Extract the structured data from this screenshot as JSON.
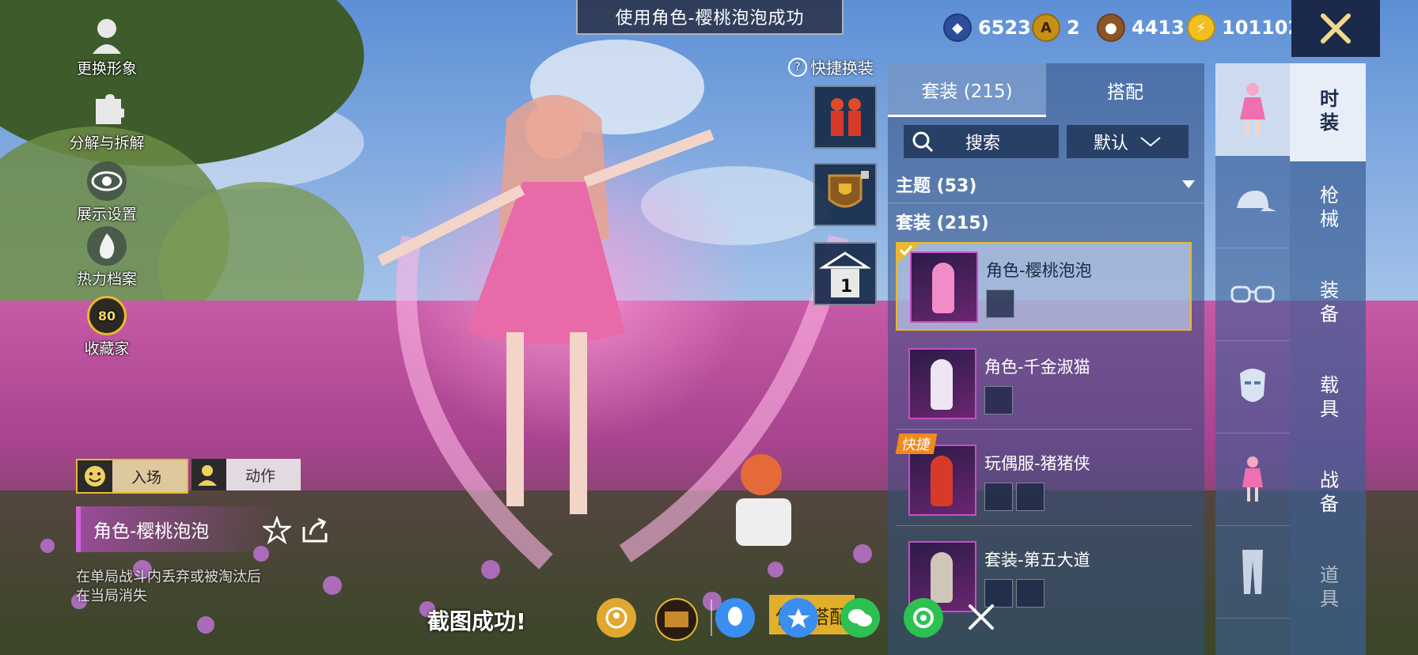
{
  "toast": "使用角色-樱桃泡泡成功",
  "currencies": [
    {
      "icon": "sapphire-coin-icon",
      "value": "6523"
    },
    {
      "icon": "gold-a-coin-icon",
      "value": "2"
    },
    {
      "icon": "bronze-coin-icon",
      "value": "4413"
    },
    {
      "icon": "lightning-coin-icon",
      "value": "101102"
    }
  ],
  "left_tools": [
    {
      "icon": "avatar-icon",
      "label": "更换形象"
    },
    {
      "icon": "puzzle-icon",
      "label": "分解与拆解"
    },
    {
      "icon": "eye-icon",
      "label": "展示设置"
    },
    {
      "icon": "flame-icon",
      "label": "热力档案"
    },
    {
      "icon": "collection-badge-icon",
      "label": "收藏家",
      "badge": "80"
    }
  ],
  "quick_change": {
    "label": "快捷换装",
    "help_icon": "?"
  },
  "quick_slots": [
    {
      "icon": "pig-suit-icon"
    },
    {
      "icon": "trophy-lock-icon"
    },
    {
      "icon": "hanger-icon",
      "count": "1"
    }
  ],
  "panel": {
    "tabs": [
      {
        "label": "套装 (215)",
        "active": true
      },
      {
        "label": "搭配",
        "active": false
      }
    ],
    "search_placeholder": "搜索",
    "sort_label": "默认",
    "theme_section": "主题 (53)",
    "suit_section": "套装 (215)",
    "items": [
      {
        "title": "角色-樱桃泡泡",
        "selected": true,
        "badge": "",
        "minis": 1
      },
      {
        "title": "角色-千金淑猫",
        "selected": false,
        "badge": "",
        "minis": 1
      },
      {
        "title": "玩偶服-猪猪侠",
        "selected": false,
        "badge": "快捷",
        "minis": 2
      },
      {
        "title": "套装-第五大道",
        "selected": false,
        "badge": "",
        "minis": 2
      }
    ]
  },
  "icon_column": [
    "outfit-icon",
    "cap-icon",
    "glasses-icon",
    "mask-icon",
    "outfit-small-icon",
    "pants-icon"
  ],
  "categories": [
    {
      "label": "时装",
      "active": true
    },
    {
      "label": "枪械",
      "active": false
    },
    {
      "label": "装备",
      "active": false
    },
    {
      "label": "载具",
      "active": false
    },
    {
      "label": "战备",
      "active": false
    },
    {
      "label": "道具",
      "active": false
    }
  ],
  "anim_buttons": {
    "entrance": "入场",
    "action": "动作"
  },
  "character": {
    "name": "角色-樱桃泡泡",
    "note_line1": "在单局战斗内丢弃或被淘汰后",
    "note_line2": "在当局消失"
  },
  "screenshot_bar": {
    "message": "截图成功!",
    "save_partial": "保",
    "save_partial2": "搭配",
    "share_targets": [
      "album-icon",
      "game-club-icon",
      "qq-icon",
      "qzone-icon",
      "wechat-icon",
      "moments-icon"
    ],
    "close": "close-icon"
  },
  "colors": {
    "gold": "#e8b830",
    "pink": "#d55fe0",
    "panel": "#3c5f96"
  }
}
